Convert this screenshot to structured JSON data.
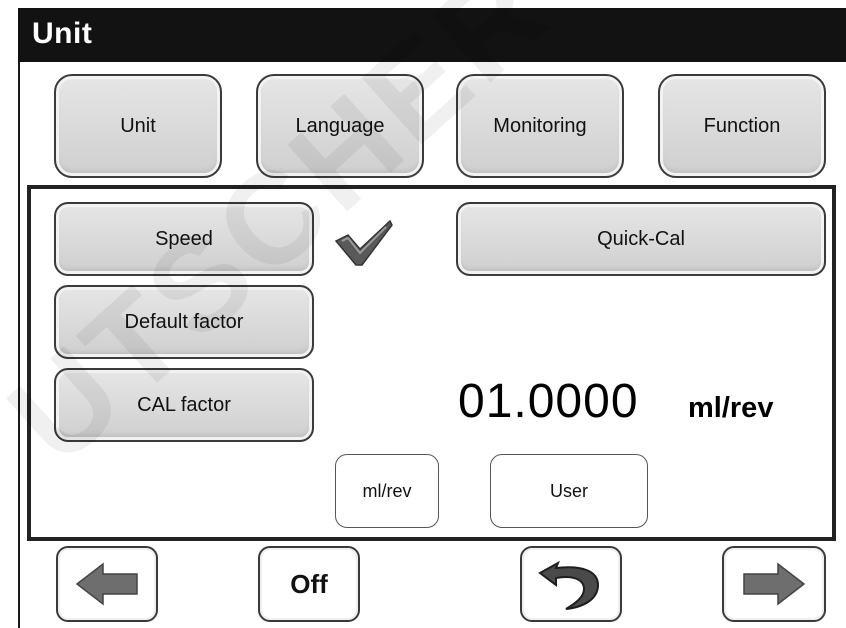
{
  "title": "Unit",
  "tabs": [
    {
      "label": "Unit"
    },
    {
      "label": "Language"
    },
    {
      "label": "Monitoring"
    },
    {
      "label": "Function"
    }
  ],
  "panel": {
    "speed_label": "Speed",
    "speed_selected": true,
    "quick_cal_label": "Quick-Cal",
    "default_factor_label": "Default factor",
    "cal_factor_label": "CAL factor",
    "value": "01.0000",
    "value_unit": "ml/rev",
    "unit_option_label": "ml/rev",
    "user_option_label": "User"
  },
  "bottom_nav": {
    "back_icon": "arrow-left-icon",
    "off_label": "Off",
    "undo_icon": "undo-arrow-icon",
    "forward_icon": "arrow-right-icon"
  },
  "colors": {
    "titlebar": "#121212",
    "button_face": "#d9d9d9",
    "arrow_gray": "#6e6e6e",
    "checkmark": "#555555"
  },
  "watermark": "UTSCHER"
}
